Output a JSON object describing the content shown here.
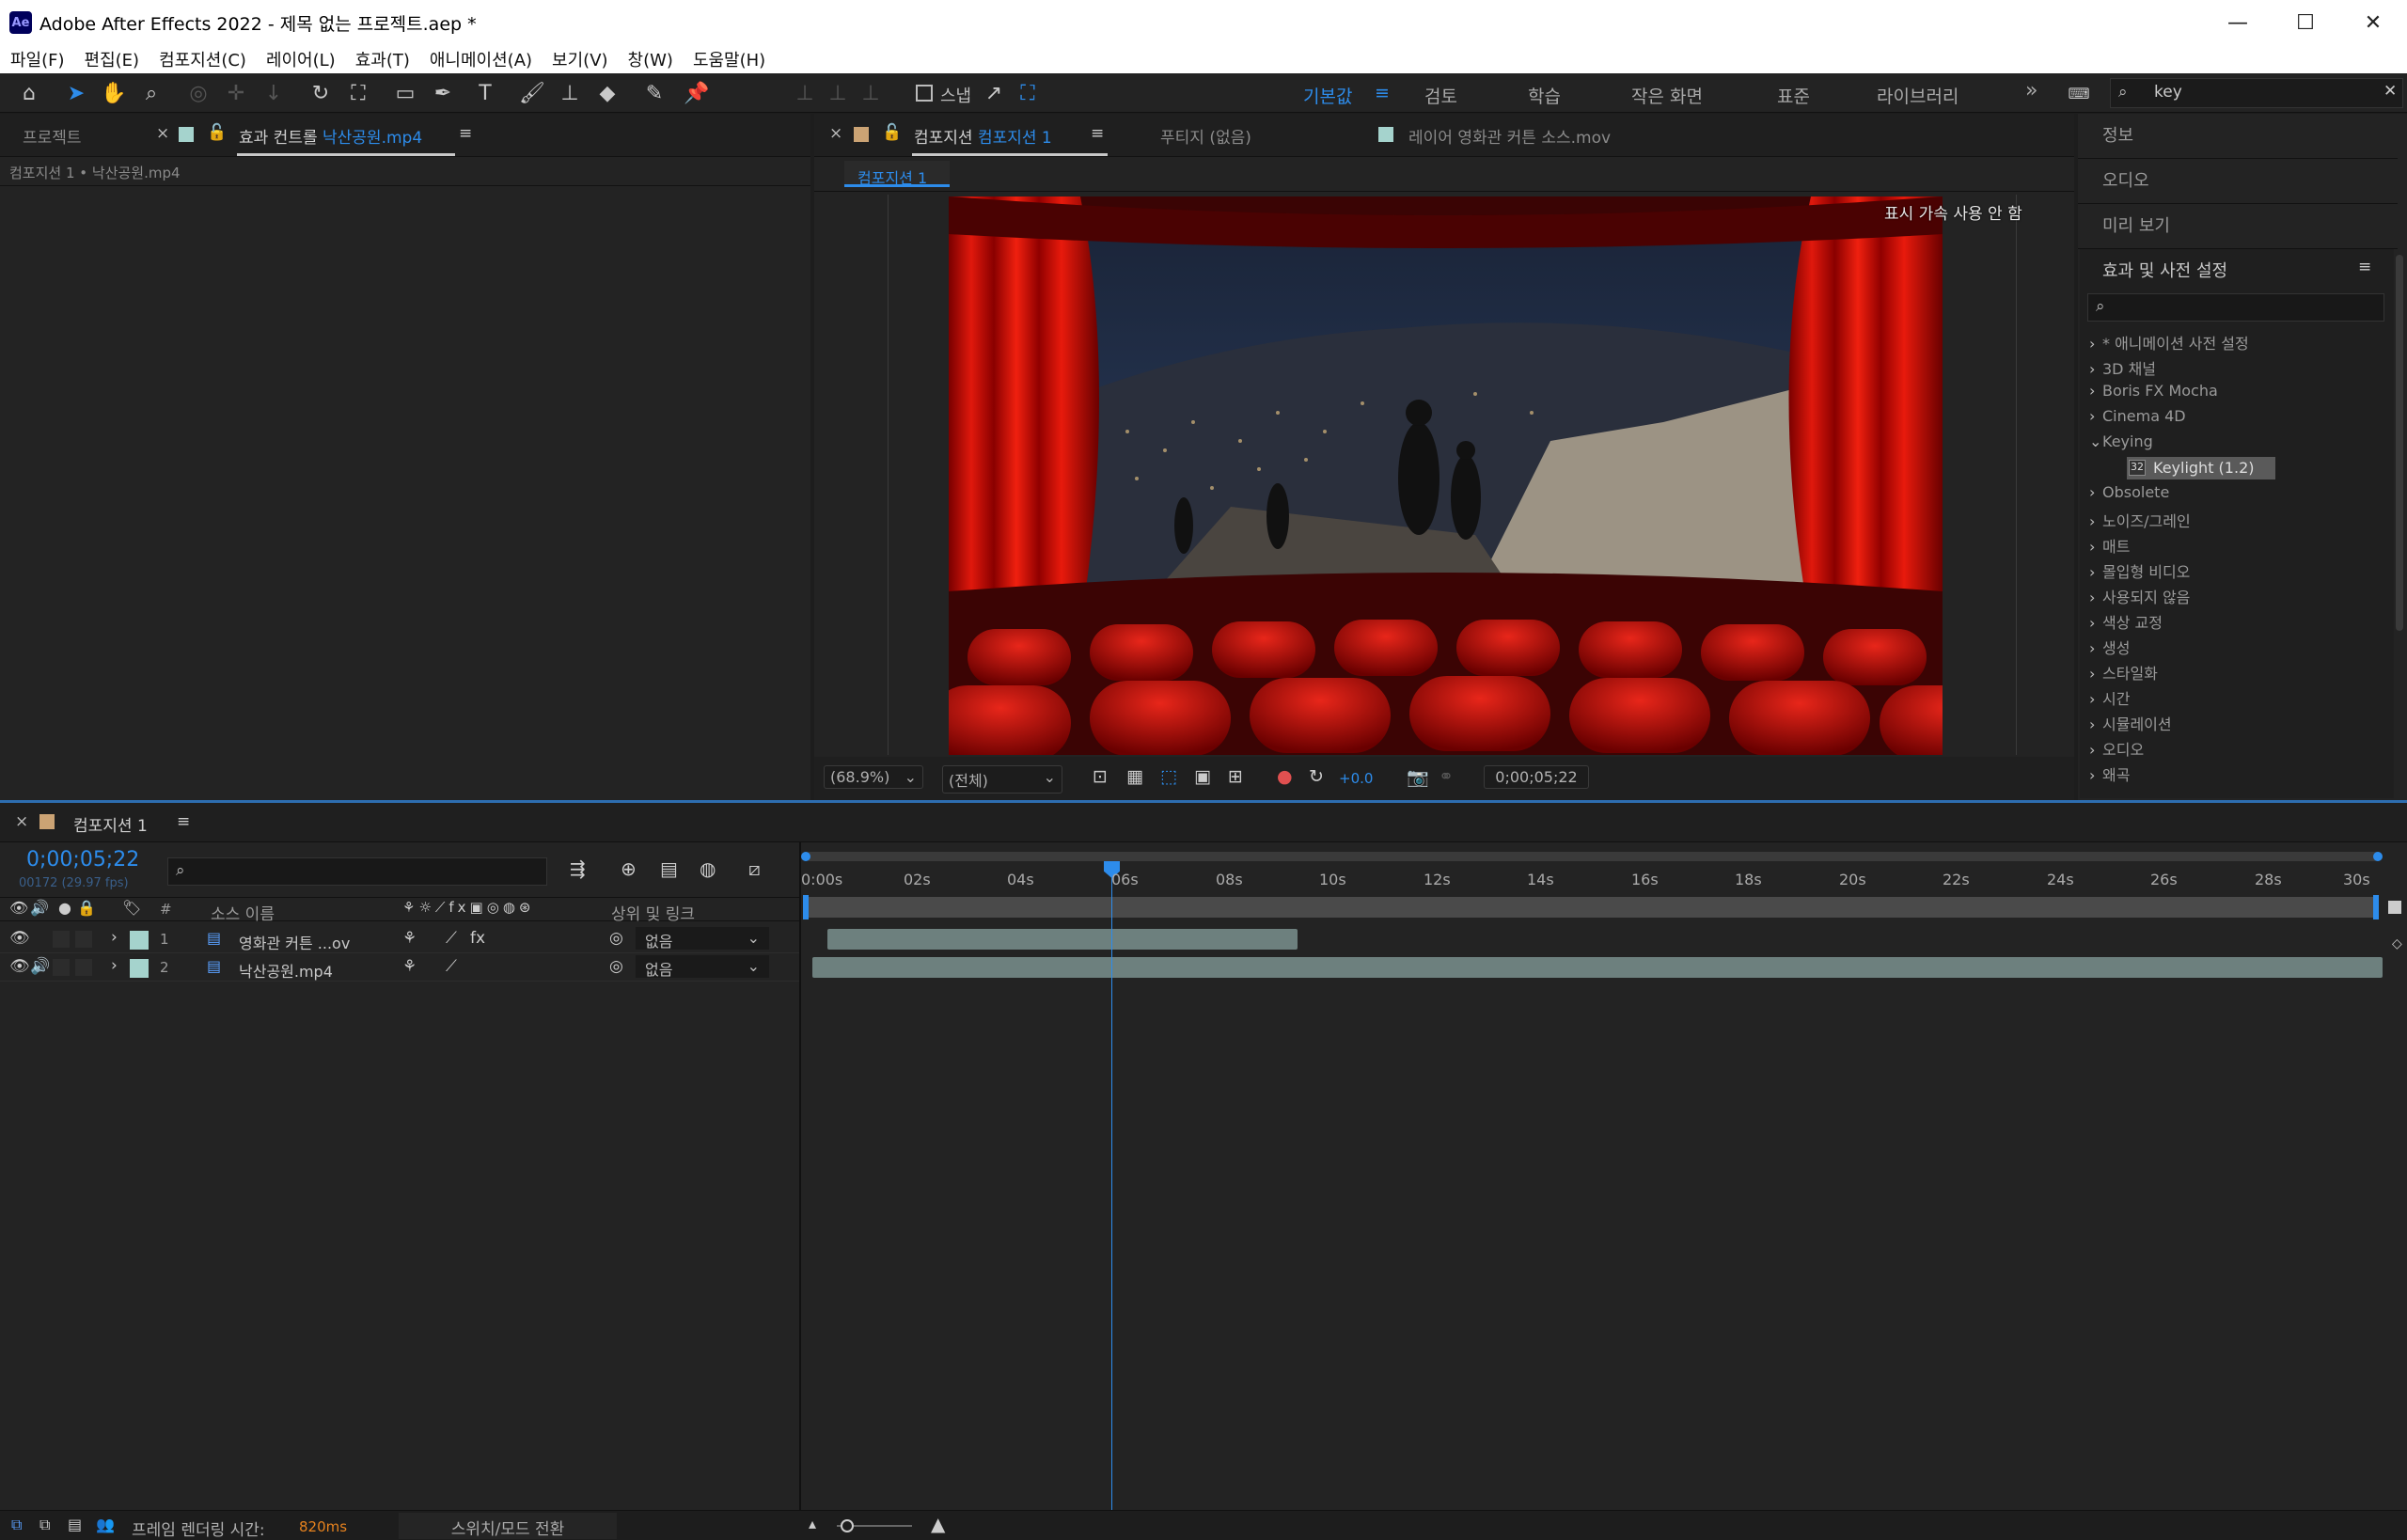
{
  "window": {
    "app_logo": "Ae",
    "title": "Adobe After Effects 2022 - 제목 없는 프로젝트.aep *",
    "minimize": "—",
    "maximize": "☐",
    "close": "✕"
  },
  "menu": [
    "파일(F)",
    "편집(E)",
    "컴포지션(C)",
    "레이어(L)",
    "효과(T)",
    "애니메이션(A)",
    "보기(V)",
    "창(W)",
    "도움말(H)"
  ],
  "toolbar": {
    "snap_label": "스냅",
    "workspaces": [
      "기본값",
      "검토",
      "학습",
      "작은 화면",
      "표준",
      "라이브러리"
    ],
    "active_workspace": "기본값",
    "more": "»",
    "search_value": "key"
  },
  "left_panel": {
    "tab_project": "프로젝트",
    "tab_effect_controls_prefix": "효과 컨트롤",
    "tab_effect_controls_file": "낙산공원.mp4",
    "breadcrumb": "컴포지션 1 • 낙산공원.mp4"
  },
  "comp_panel": {
    "tab_prefix": "컴포지션",
    "tab_name": "컴포지션 1",
    "footage_tab": "푸티지 (없음)",
    "layer_tab": "레이어 영화관 커튼 소스.mov",
    "sub_tab": "컴포지션 1",
    "overlay": "표시 가속 사용 안 함",
    "zoom": "(68.9%)",
    "resolution": "(전체)",
    "exposure": "+0.0",
    "timecode": "0;00;05;22"
  },
  "right_panel": {
    "items": [
      "정보",
      "오디오",
      "미리 보기"
    ],
    "effects_title": "효과 및 사전 설정",
    "effects": [
      {
        "label": "* 애니메이션 사전 설정",
        "open": false
      },
      {
        "label": "3D 채널",
        "open": false
      },
      {
        "label": "Boris FX Mocha",
        "open": false
      },
      {
        "label": "Cinema 4D",
        "open": false
      },
      {
        "label": "Keying",
        "open": true
      },
      {
        "label": "Keylight (1.2)",
        "child": true
      },
      {
        "label": "Obsolete",
        "open": false
      },
      {
        "label": "노이즈/그레인",
        "open": false
      },
      {
        "label": "매트",
        "open": false
      },
      {
        "label": "몰입형 비디오",
        "open": false
      },
      {
        "label": "사용되지 않음",
        "open": false
      },
      {
        "label": "색상 교정",
        "open": false
      },
      {
        "label": "생성",
        "open": false
      },
      {
        "label": "스타일화",
        "open": false
      },
      {
        "label": "시간",
        "open": false
      },
      {
        "label": "시뮬레이션",
        "open": false
      },
      {
        "label": "오디오",
        "open": false
      },
      {
        "label": "왜곡",
        "open": false
      }
    ],
    "keylight_badge": "32"
  },
  "timeline": {
    "tab": "컴포지션 1",
    "timecode": "0;00;05;22",
    "timecode_sub": "00172 (29.97 fps)",
    "col_num": "#",
    "col_source": "소스 이름",
    "col_parent": "상위 및 링크",
    "layers": [
      {
        "num": "1",
        "name": "영화관 커튼 ...ov",
        "parent": "없음",
        "color": "#a5d3cd"
      },
      {
        "num": "2",
        "name": "낙산공원.mp4",
        "parent": "없음",
        "color": "#a5d3cd"
      }
    ],
    "ticks": [
      "0:00s",
      "02s",
      "04s",
      "06s",
      "08s",
      "10s",
      "12s",
      "14s",
      "16s",
      "18s",
      "20s",
      "22s",
      "24s",
      "26s",
      "28s",
      "30s"
    ]
  },
  "status": {
    "render_label": "프레임 렌더링 시간:",
    "render_time": "820ms",
    "toggle": "스위치/모드 전환"
  }
}
